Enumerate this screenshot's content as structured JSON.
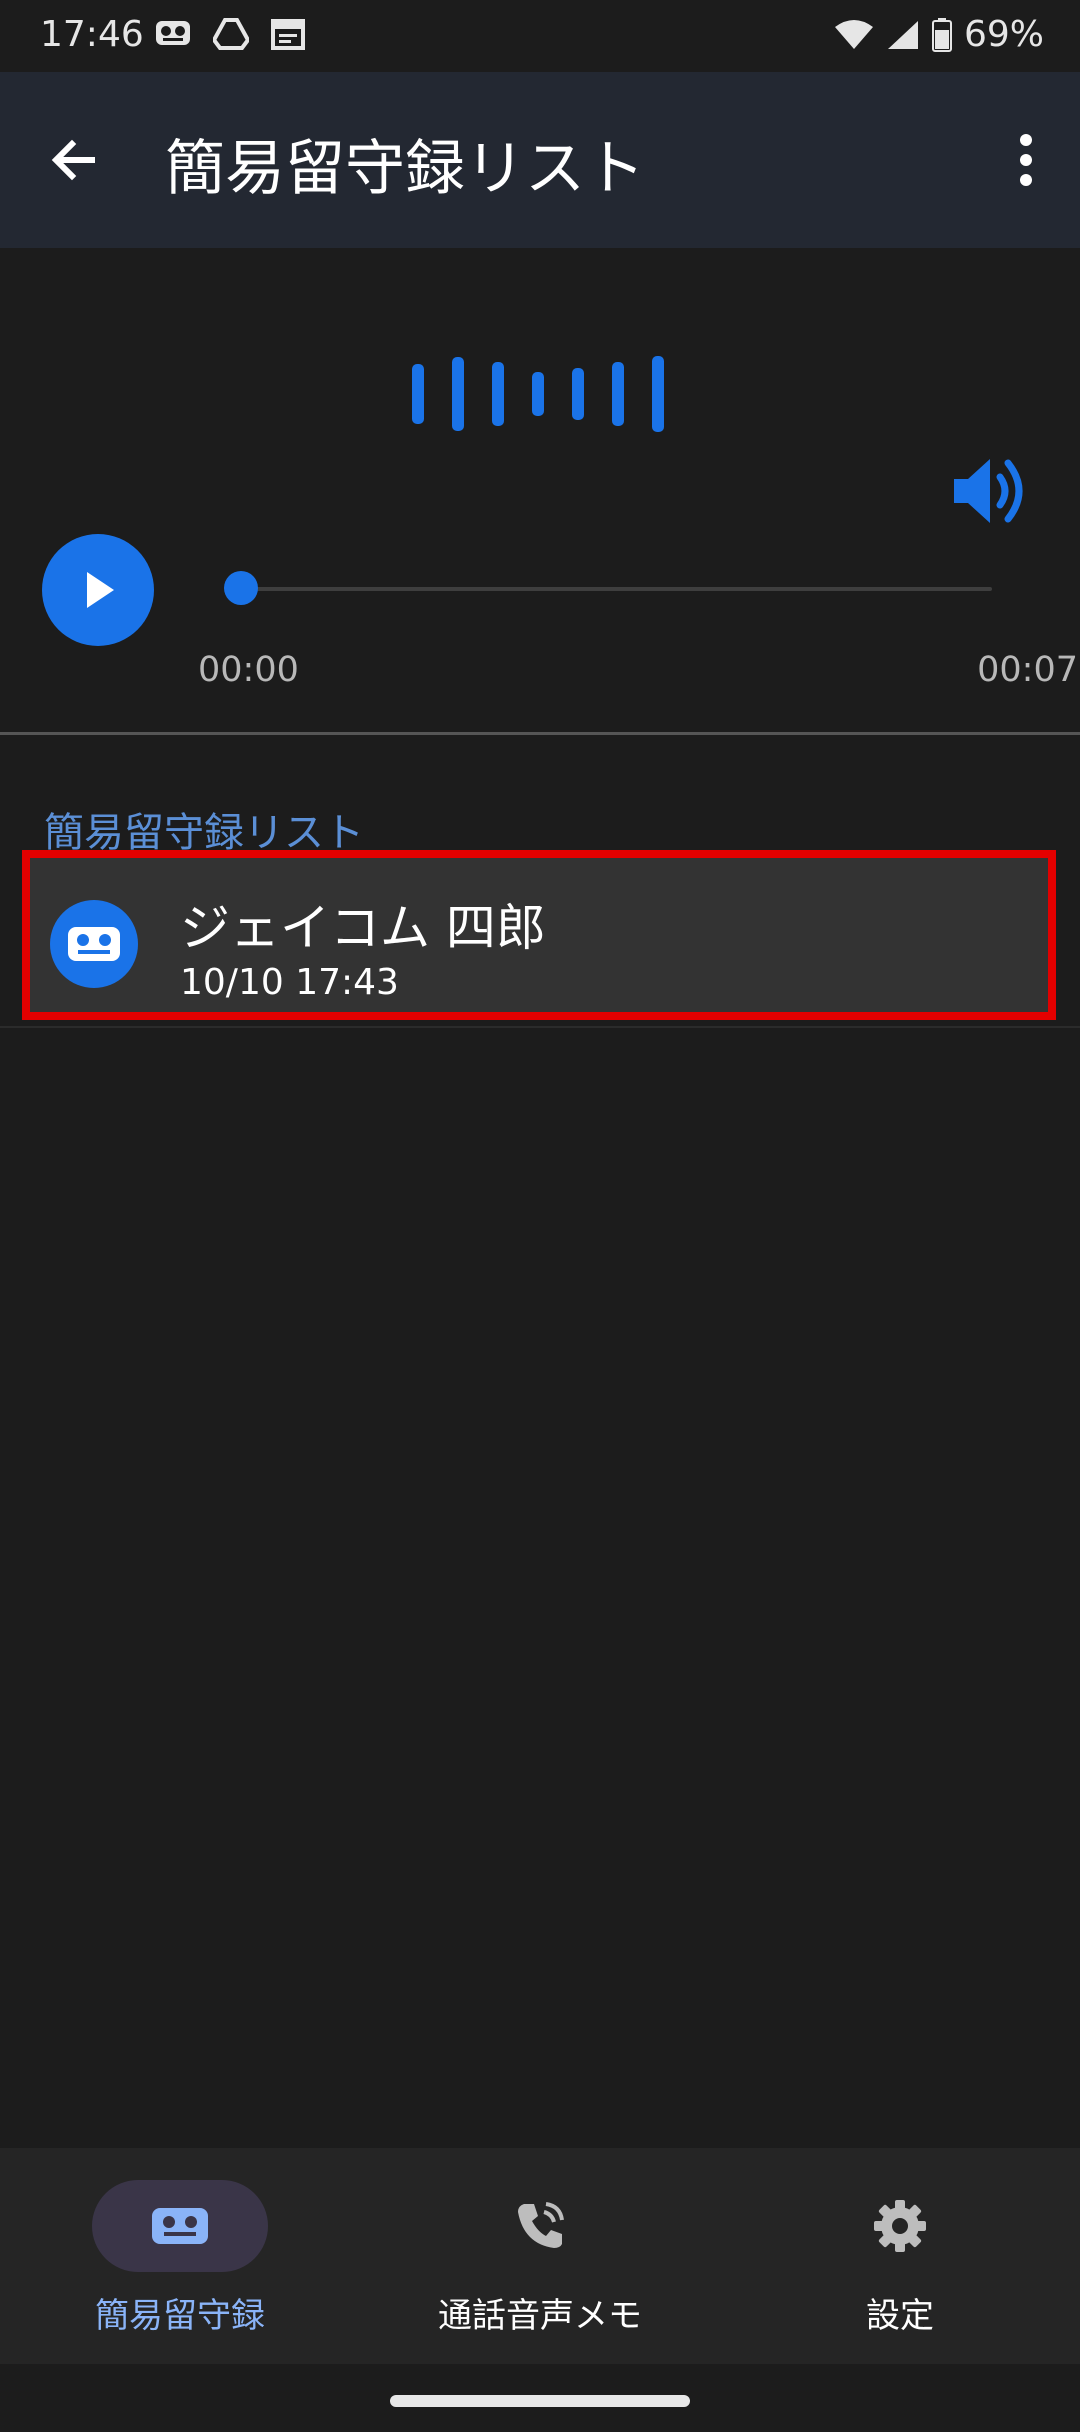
{
  "status_bar": {
    "time": "17:46",
    "battery": "69%",
    "icons": [
      "voicemail-icon",
      "drive-icon",
      "calendar-icon",
      "wifi-icon",
      "cell-signal-icon",
      "battery-icon"
    ]
  },
  "app_bar": {
    "title": "簡易留守録リスト",
    "back_icon": "arrow-back-icon",
    "menu_icon": "more-vert-icon"
  },
  "player": {
    "current_time": "00:00",
    "total_time": "00:07",
    "progress": 0,
    "colors": {
      "accent": "#1a73e8"
    }
  },
  "list": {
    "section_title": "簡易留守録リスト",
    "items": [
      {
        "name": "ジェイコム 四郎",
        "date": "10/10 17:43",
        "icon": "voicemail-icon",
        "highlighted": true
      }
    ]
  },
  "bottom_nav": {
    "items": [
      {
        "label": "簡易留守録",
        "icon": "voicemail-icon",
        "active": true
      },
      {
        "label": "通話音声メモ",
        "icon": "phone-call-icon",
        "active": false
      },
      {
        "label": "設定",
        "icon": "gear-icon",
        "active": false
      }
    ]
  }
}
